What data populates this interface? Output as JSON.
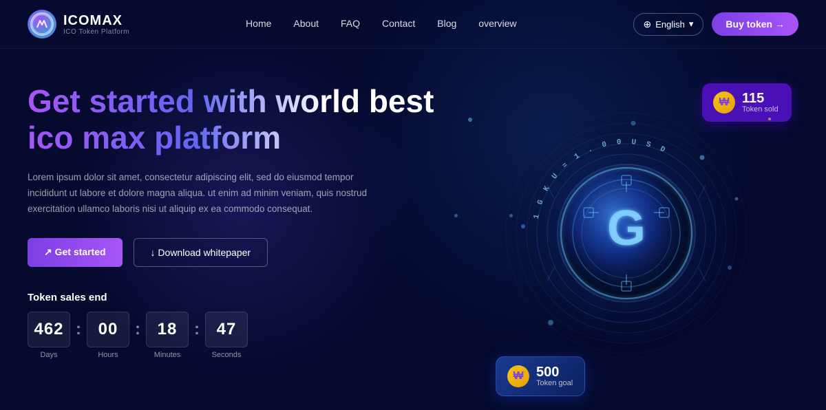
{
  "logo": {
    "name": "ICOMAX",
    "subtitle": "ICO Token Platform",
    "icon_text": "🐺"
  },
  "nav": {
    "links": [
      {
        "label": "Home",
        "href": "#"
      },
      {
        "label": "About",
        "href": "#"
      },
      {
        "label": "FAQ",
        "href": "#"
      },
      {
        "label": "Contact",
        "href": "#"
      },
      {
        "label": "Blog",
        "href": "#"
      },
      {
        "label": "overview",
        "href": "#"
      }
    ],
    "lang_btn": "English",
    "buy_btn": "Buy token →"
  },
  "hero": {
    "title": "Get started with world best ico max platform",
    "description": "Lorem ipsum dolor sit amet, consectetur adipiscing elit, sed do eiusmod tempor incididunt ut labore et dolore magna aliqua. ut enim ad minim veniam, quis nostrud exercitation ullamco laboris nisi ut aliquip ex ea commodo consequat.",
    "btn_get_started": "↗ Get started",
    "btn_download": "↓ Download whitepaper"
  },
  "countdown": {
    "label": "Token sales end",
    "days": {
      "value": "462",
      "unit": "Days"
    },
    "hours": {
      "value": "00",
      "unit": "Hours"
    },
    "minutes": {
      "value": "18",
      "unit": "Minutes"
    },
    "seconds": {
      "value": "47",
      "unit": "Seconds"
    }
  },
  "badge_sold": {
    "number": "115",
    "label": "Token sold",
    "icon": "₩"
  },
  "badge_goal": {
    "number": "500",
    "label": "Token goal",
    "icon": "₩"
  },
  "coin": {
    "arc_text": "1 GKU = 1 . 00 USD",
    "center_letter": "G"
  },
  "colors": {
    "bg": "#050a2e",
    "accent_purple": "#7b3fe4",
    "accent_blue": "#1a4fc4",
    "badge_bg": "#4a0fb5"
  }
}
